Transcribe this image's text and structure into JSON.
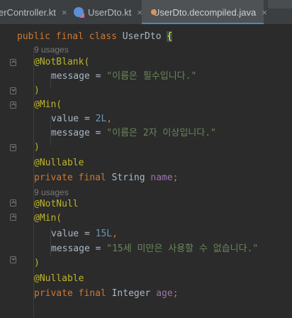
{
  "tabs": [
    {
      "label": "erController.kt",
      "close": "×",
      "icon": "kotlin-file-icon"
    },
    {
      "label": "UserDto.kt",
      "close": "×",
      "icon": "kotlin-file-icon"
    },
    {
      "label": "UserDto.decompiled.java",
      "close": "×",
      "icon": "java-file-icon"
    }
  ],
  "code": {
    "class_kw1": "public",
    "class_kw2": "final",
    "class_kw3": "class",
    "class_name": "UserDto",
    "class_brace": "{",
    "usages1": "9 usages",
    "ann_notblank": "@NotBlank(",
    "msg_key": "message",
    "eq": " = ",
    "msg1": "\"이름은 필수입니다.\"",
    "close_paren": ")",
    "ann_min1": "@Min(",
    "value_key": "value",
    "val1": "2L",
    "comma": ",",
    "msg2": "\"이름은 2자 이상입니다.\"",
    "ann_nullable": "@Nullable",
    "kw_private": "private",
    "kw_final": "final",
    "type_string": "String",
    "field_name": "name",
    "semi": ";",
    "usages2": "9 usages",
    "ann_notnull": "@NotNull",
    "ann_min2": "@Min(",
    "val2": "15L",
    "msg3": "\"15세 미만은 사용할 수 없습니다.\"",
    "ann_nullable2": "@Nullable",
    "type_integer": "Integer",
    "field_age": "age"
  },
  "colors": {
    "keyword": "#cc7832",
    "annotation": "#bbb529",
    "string": "#6a8759",
    "number": "#6897bb",
    "field": "#9876aa",
    "text": "#a9b7c6"
  }
}
